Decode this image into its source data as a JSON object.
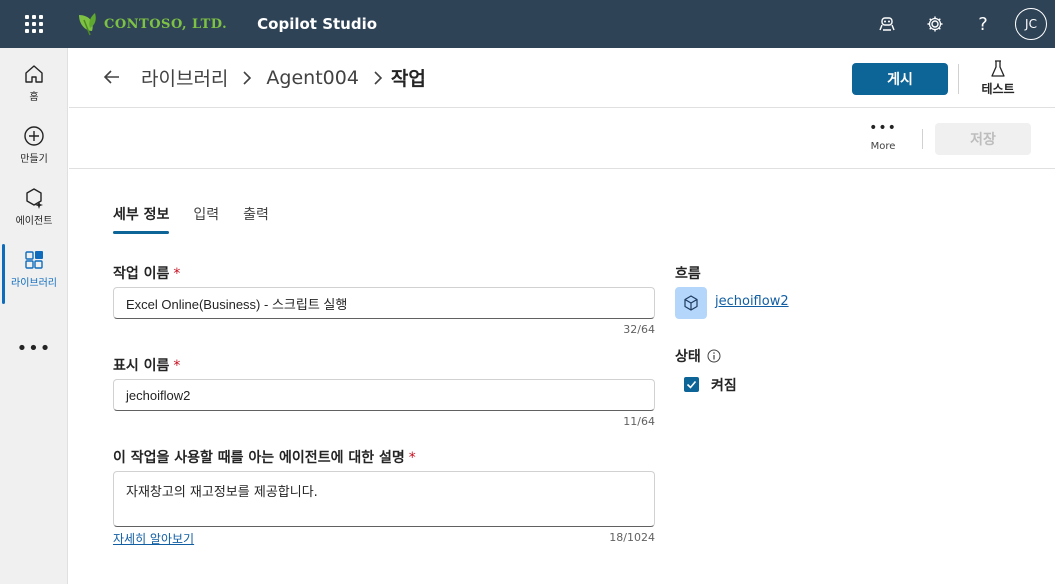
{
  "topbar": {
    "brand": "CONTOSO, LTD.",
    "app_name": "Copilot Studio",
    "avatar_initials": "JC",
    "icons": [
      "waffle-icon",
      "leaf-logo",
      "agent-icon",
      "gear-icon",
      "help-icon"
    ]
  },
  "rail": {
    "items": [
      {
        "label": "홈",
        "icon": "home-icon"
      },
      {
        "label": "만들기",
        "icon": "plus-circle-icon"
      },
      {
        "label": "에이전트",
        "icon": "agent-sparkle-icon"
      },
      {
        "label": "라이브러리",
        "icon": "library-icon"
      }
    ],
    "more": "•••"
  },
  "header": {
    "breadcrumbs": [
      "라이브러리",
      "Agent004",
      "작업"
    ],
    "publish_label": "게시",
    "test_label": "테스트"
  },
  "commandbar": {
    "more_label": "More",
    "save_label": "저장"
  },
  "tabs": [
    {
      "label": "세부 정보",
      "active": true
    },
    {
      "label": "입력",
      "active": false
    },
    {
      "label": "출력",
      "active": false
    }
  ],
  "form": {
    "action_name": {
      "label": "작업 이름",
      "required": "*",
      "value": "Excel Online(Business) - 스크립트 실행",
      "counter": "32/64"
    },
    "display_name": {
      "label": "표시 이름",
      "required": "*",
      "value": "jechoiflow2",
      "counter": "11/64"
    },
    "description": {
      "label": "이 작업을 사용할 때를 아는 에이전트에 대한 설명",
      "required": "*",
      "value": "자재창고의 재고정보를 제공합니다.",
      "counter": "18/1024",
      "learn_more": "자세히 알아보기"
    }
  },
  "side": {
    "flow_label": "흐름",
    "flow_name": "jechoiflow2",
    "status_label": "상태",
    "status_checkbox_label": "켜짐",
    "status_checked": true
  },
  "colors": {
    "topbar": "#2f4357",
    "accent": "#0d6496",
    "brand_green": "#7dc243",
    "required": "#c50f1f"
  }
}
